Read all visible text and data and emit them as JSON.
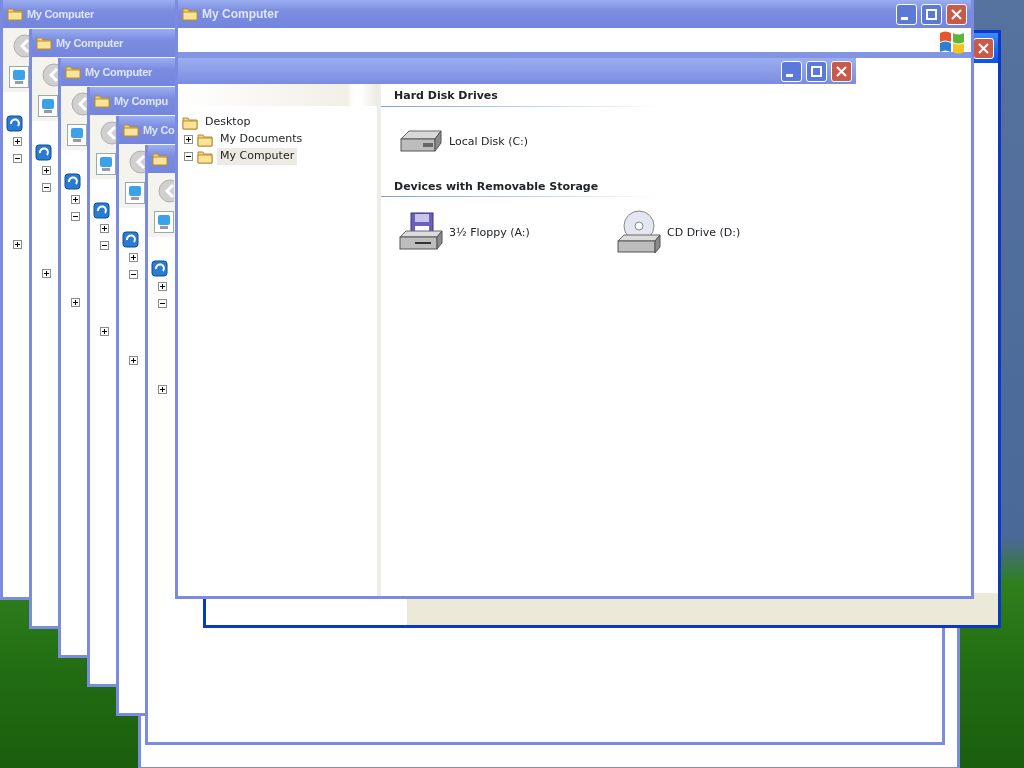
{
  "background_windows": [
    {
      "title": "My Computer"
    },
    {
      "title": "My Computer"
    },
    {
      "title": "My Computer"
    },
    {
      "title": "My Compu"
    },
    {
      "title": "My Co"
    },
    {
      "kind": "window"
    }
  ],
  "window": {
    "title": "My Computer",
    "tree": [
      {
        "label": "Desktop",
        "selected": false,
        "children": [
          {
            "label": "My Documents",
            "expanded": false,
            "selected": false
          },
          {
            "label": "My Computer",
            "expanded": true,
            "selected": true
          }
        ]
      }
    ],
    "sections": [
      {
        "heading": "Hard Disk Drives",
        "items": [
          {
            "label": "Local Disk (C:)",
            "kind": "hdd"
          }
        ]
      },
      {
        "heading": "Devices with Removable Storage",
        "items": [
          {
            "label": "3½ Floppy (A:)",
            "kind": "floppy"
          },
          {
            "label": "CD Drive (D:)",
            "kind": "cd"
          }
        ]
      }
    ]
  }
}
